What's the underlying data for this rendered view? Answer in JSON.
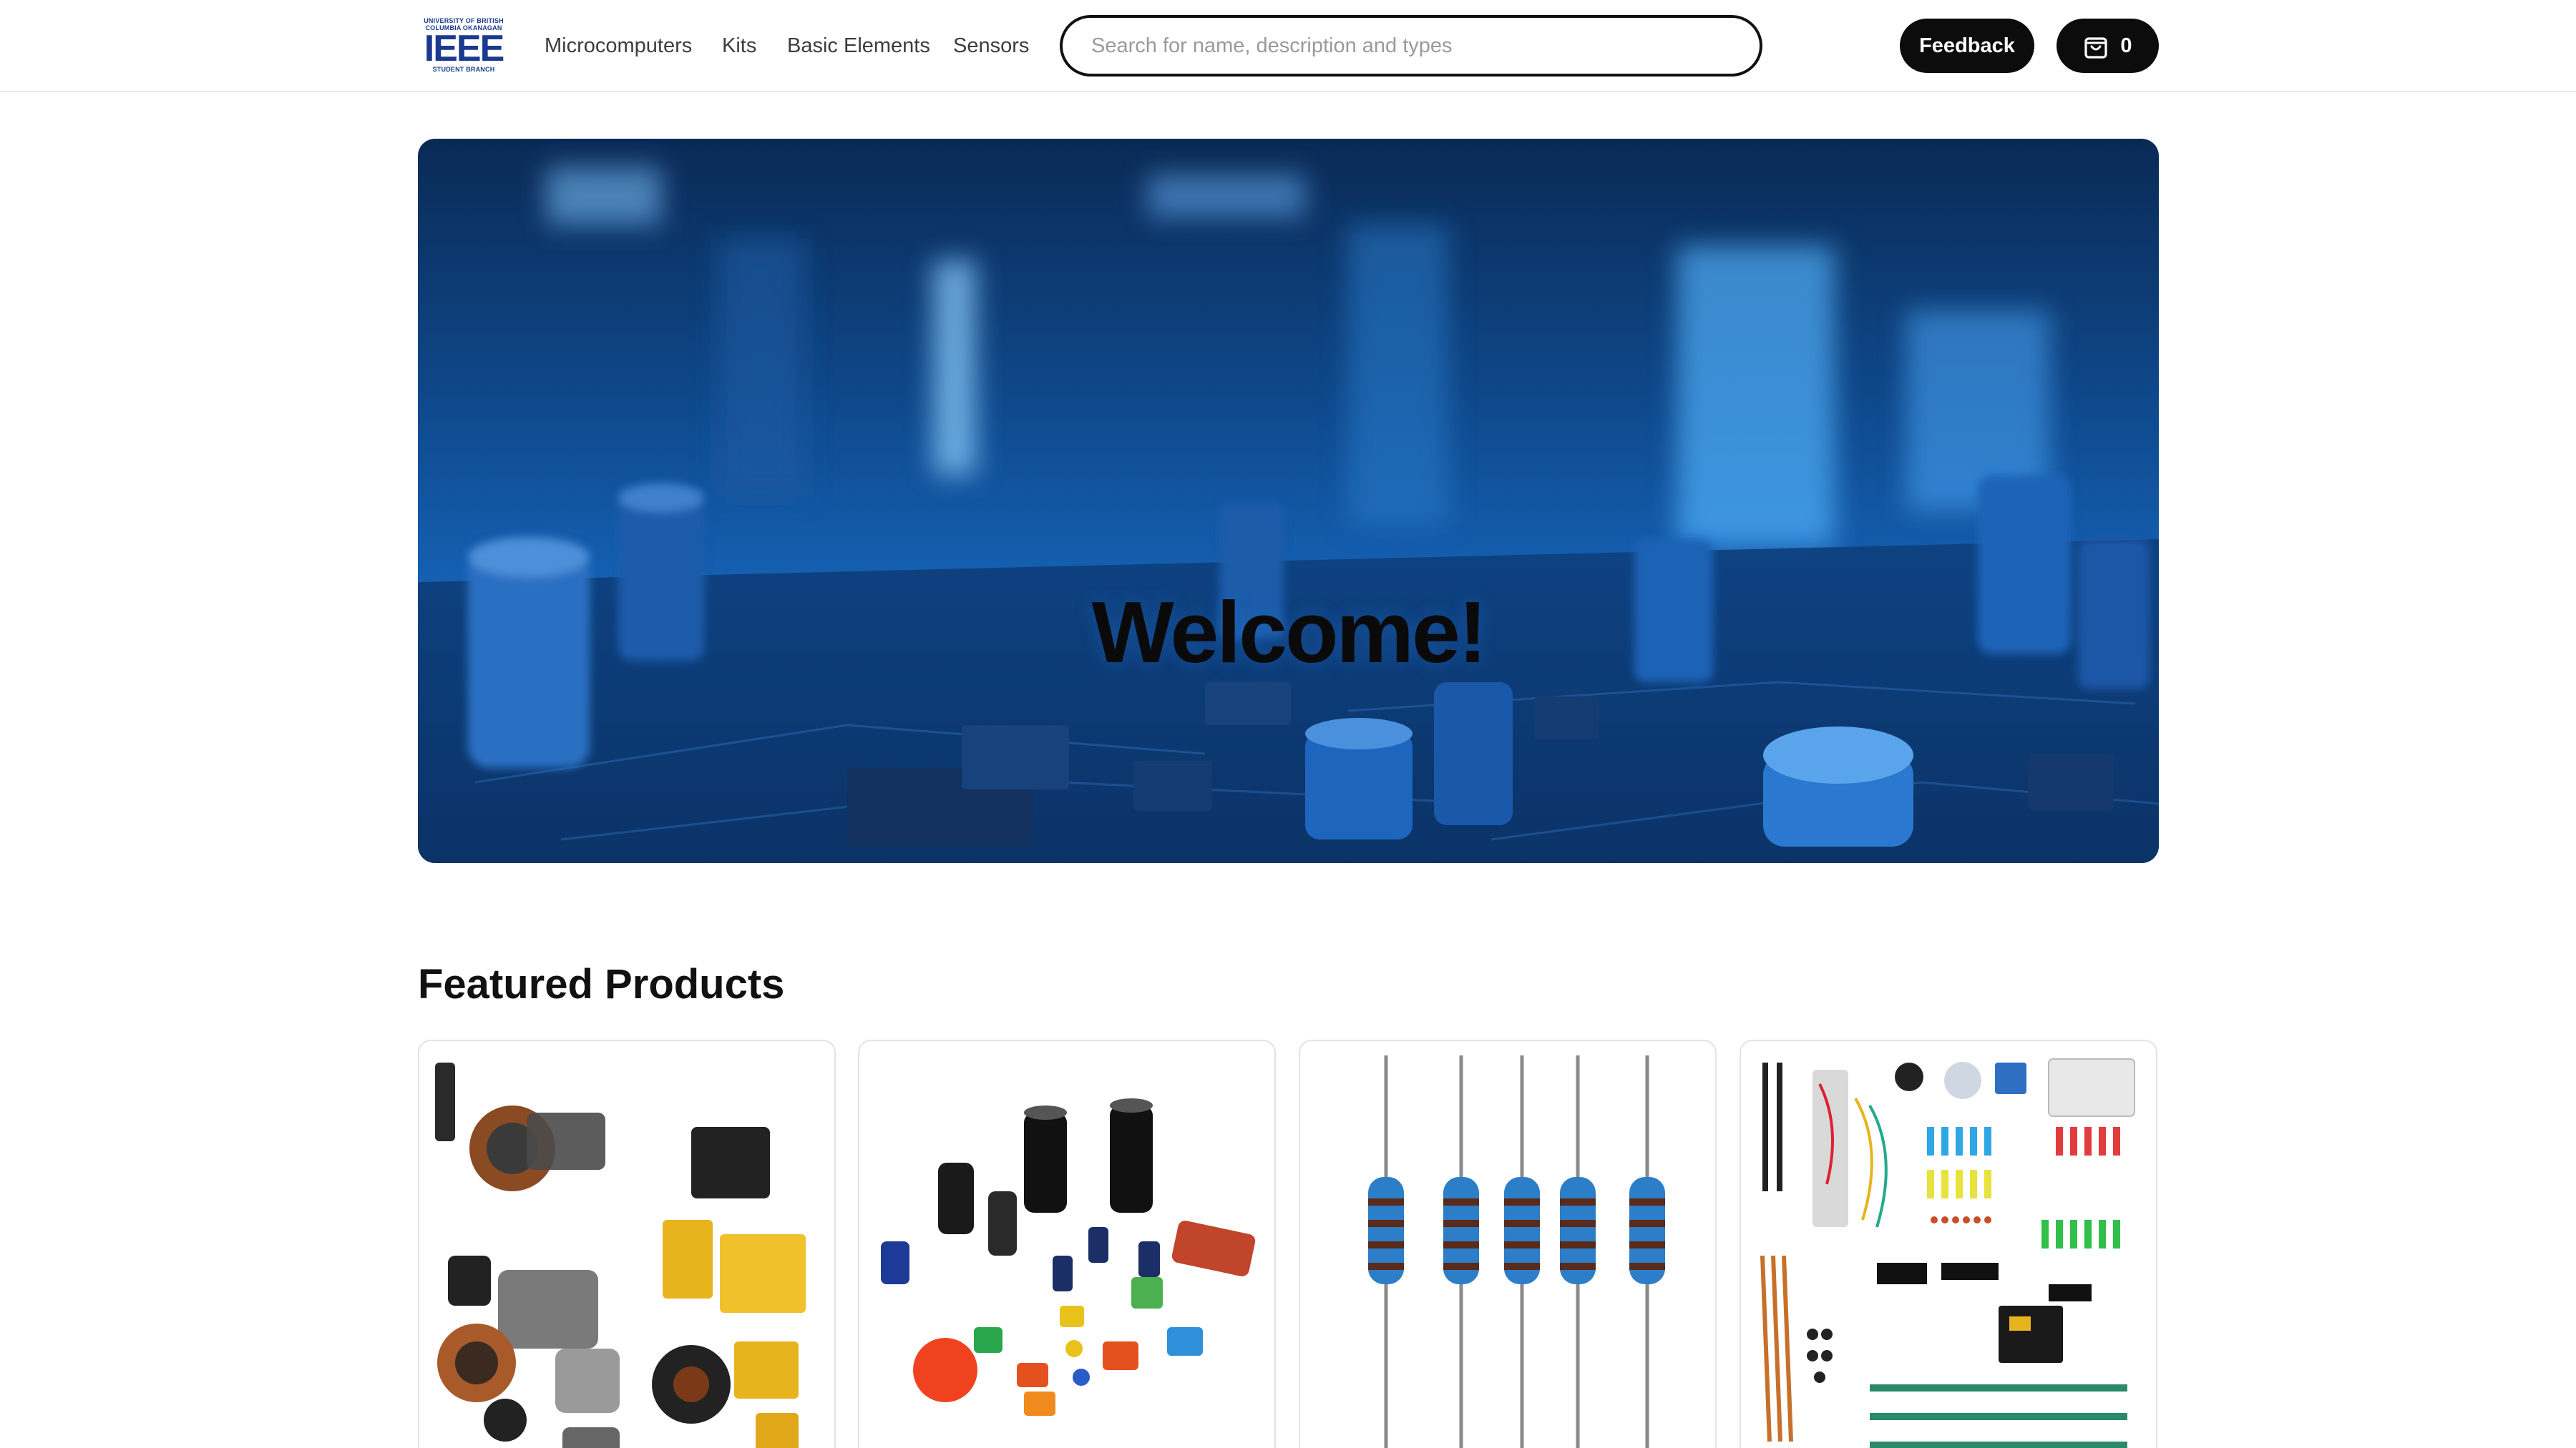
{
  "header": {
    "logo": {
      "top_line": "UNIVERSITY OF BRITISH",
      "second_line": "COLUMBIA OKANAGAN",
      "main": "IEEE",
      "bottom_line": "STUDENT BRANCH"
    },
    "nav": [
      "Microcomputers",
      "Kits",
      "Basic Elements",
      "Sensors"
    ],
    "search": {
      "placeholder": "Search for name, description and types",
      "value": ""
    },
    "feedback_label": "Feedback",
    "cart": {
      "icon": "shopping-bag-icon",
      "count": "0"
    }
  },
  "hero": {
    "title": "Welcome!"
  },
  "featured": {
    "title": "Featured Products",
    "products": [
      {
        "image": "inductors-and-transformers"
      },
      {
        "image": "assorted-capacitors"
      },
      {
        "image": "resistors"
      },
      {
        "image": "electronics-component-kit"
      }
    ]
  },
  "colors": {
    "accent": "#0c0c0c",
    "logo_blue": "#1b3a8f",
    "hero_blue": "#1561b4"
  }
}
